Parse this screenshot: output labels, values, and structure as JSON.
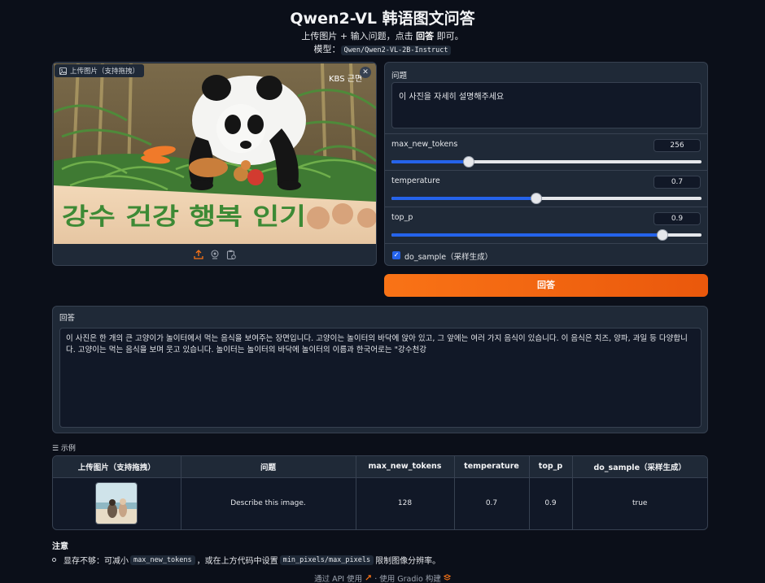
{
  "header": {
    "title": "Qwen2-VL 韩语图文问答",
    "subtitle_pre": "上传图片 + 输入问题，点击 ",
    "subtitle_bold": "回答",
    "subtitle_post": " 即可。",
    "model_label": "模型：",
    "model_name": "Qwen/Qwen2-VL-2B-Instruct"
  },
  "image_input": {
    "label": "上传图片（支持拖拽）",
    "close_glyph": "✕",
    "overlay_text": "KBS 근면",
    "caption_text": "강수 건강 행복 인기"
  },
  "controls": {
    "question_label": "问题",
    "question_value": "이 사진을 자세히 설명해주세요",
    "max_new_tokens": {
      "label": "max_new_tokens",
      "value": "256",
      "fraction": 0.25
    },
    "temperature": {
      "label": "temperature",
      "value": "0.7",
      "fraction": 0.466
    },
    "top_p": {
      "label": "top_p",
      "value": "0.9",
      "fraction": 0.874
    },
    "do_sample": {
      "label": "do_sample（采样生成）",
      "checked": true,
      "check_glyph": "✓"
    }
  },
  "submit_label": "回答",
  "answer": {
    "label": "回答",
    "text": "이 사진은 한 개의 큰 고양이가 놀이터에서 먹는 음식을 보여주는 장면입니다. 고양이는 놀이터의 바닥에 앉아 있고, 그 앞에는 여러 가지 음식이 있습니다. 이 음식은 치즈, 양파, 과일 등 다양합니다. 고양이는 먹는 음식을 보며 웃고 있습니다. 놀이터는 놀이터의 바닥에 놀이터의 이름과 한국어로는 \"강수천강"
  },
  "examples": {
    "label": "☰ 示例",
    "headers": [
      "上传图片（支持拖拽）",
      "问题",
      "max_new_tokens",
      "temperature",
      "top_p",
      "do_sample（采样生成）"
    ],
    "row": {
      "question": "Describe this image.",
      "max_new_tokens": "128",
      "temperature": "0.7",
      "top_p": "0.9",
      "do_sample": "true"
    }
  },
  "notes": {
    "title": "注意",
    "item_pre": "显存不够：可减小 ",
    "item_code1": "max_new_tokens",
    "item_mid": "，或在上方代码中设置 ",
    "item_code2": "min_pixels/max_pixels",
    "item_post": " 限制图像分辨率。"
  },
  "footer": {
    "api_text": "通过 API 使用",
    "separator": "·",
    "built_text": "使用 Gradio 构建"
  },
  "colors": {
    "accent": "#f97316",
    "slider": "#2563eb",
    "background": "#0b0f19"
  }
}
